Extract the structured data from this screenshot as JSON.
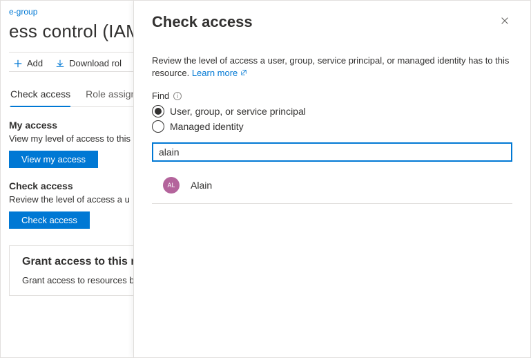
{
  "breadcrumb": {
    "text": "e-group"
  },
  "page_title": "ess control (IAM)",
  "toolbar": {
    "add_label": "Add",
    "download_label": "Download rol"
  },
  "tabs": [
    {
      "label": "Check access",
      "active": true
    },
    {
      "label": "Role assign",
      "active": false
    }
  ],
  "my_access": {
    "heading": "My access",
    "description": "View my level of access to this",
    "button": "View my access"
  },
  "check_access": {
    "heading": "Check access",
    "description": "Review the level of access a u",
    "button": "Check access"
  },
  "grant_card": {
    "heading": "Grant access to this re",
    "description": "Grant access to resources b"
  },
  "flyout": {
    "title": "Check access",
    "description_pre": "Review the level of access a user, group, service principal, or managed identity has to this resource. ",
    "learn_more": "Learn more",
    "find_label": "Find",
    "radios": {
      "user": "User, group, or service principal",
      "managed": "Managed identity"
    },
    "selected_radio": "user",
    "search_value": "alain",
    "result": {
      "initials": "AL",
      "name": "Alain"
    }
  }
}
